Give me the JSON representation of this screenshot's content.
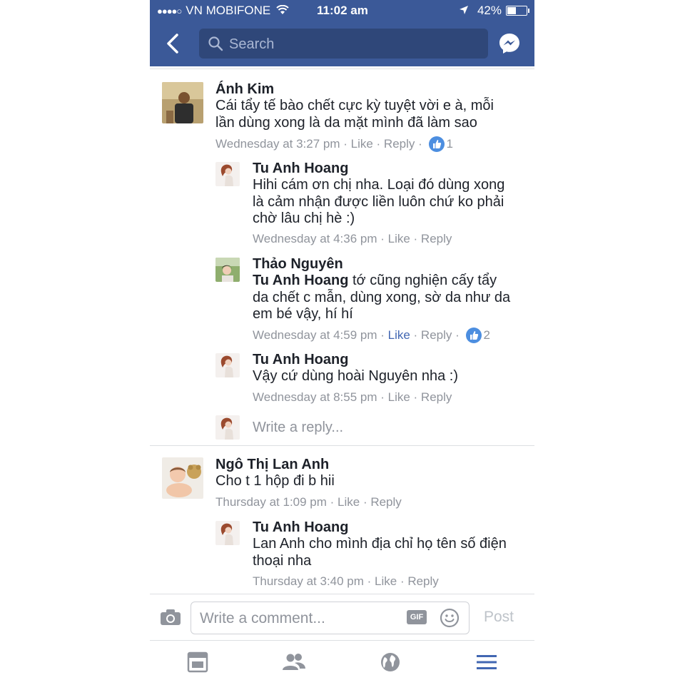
{
  "status_bar": {
    "signal": "●●●●○",
    "carrier": "VN MOBIFONE",
    "time": "11:02 am",
    "battery_text": "42%",
    "battery_level": 0.42
  },
  "header": {
    "search_placeholder": "Search"
  },
  "comments": [
    {
      "author": "Ánh Kim",
      "text_lines": [
        "Cái tẩy tế bào chết cực kỳ tuyệt vời e à, mỗi",
        "lần dùng xong là da mặt mình đã làm sao"
      ],
      "time": "Wednesday at 3:27 pm",
      "like": "Like",
      "reply": "Reply",
      "reactions": "1",
      "replies": [
        {
          "author": "Tu Anh Hoang",
          "text_lines": [
            "Hihi cám ơn chị nha. Loại đó dùng xong",
            "là cảm nhận được liền luôn chứ ko phải",
            "chờ lâu chị hè :)"
          ],
          "time": "Wednesday at 4:36 pm",
          "like": "Like",
          "reply": "Reply"
        },
        {
          "author": "Thảo Nguyên",
          "mention": "Tu Anh Hoang",
          "text_lines": [
            " tớ cũng nghiện cấy tẩy",
            "da chết c mẫn, dùng xong, sờ da như da",
            "em bé vậy, hí hí"
          ],
          "time": "Wednesday at 4:59 pm",
          "like": "Like",
          "reply": "Reply",
          "reactions": "2"
        },
        {
          "author": "Tu Anh Hoang",
          "text_lines": [
            "Vậy cứ dùng hoài Nguyên nha :)"
          ],
          "time": "Wednesday at 8:55 pm",
          "like": "Like",
          "reply": "Reply"
        }
      ],
      "write_reply_placeholder": "Write a reply..."
    },
    {
      "author": "Ngô Thị Lan Anh",
      "text_lines": [
        "Cho t 1 hộp đi b hii"
      ],
      "time": "Thursday at 1:09 pm",
      "like": "Like",
      "reply": "Reply",
      "replies": [
        {
          "author": "Tu Anh Hoang",
          "text_lines": [
            "Lan Anh cho mình địa chỉ họ tên số điện",
            "thoại nha"
          ],
          "time": "Thursday at 3:40 pm",
          "like": "Like",
          "reply": "Reply"
        }
      ]
    }
  ],
  "composer": {
    "placeholder": "Write a comment...",
    "gif_label": "GIF",
    "post_label": "Post"
  },
  "tabs": [
    "news-feed-icon",
    "friends-icon",
    "globe-icon",
    "menu-icon"
  ],
  "colors": {
    "header": "#3b5998",
    "link_blue": "#4267b2",
    "meta_gray": "#90949c"
  }
}
